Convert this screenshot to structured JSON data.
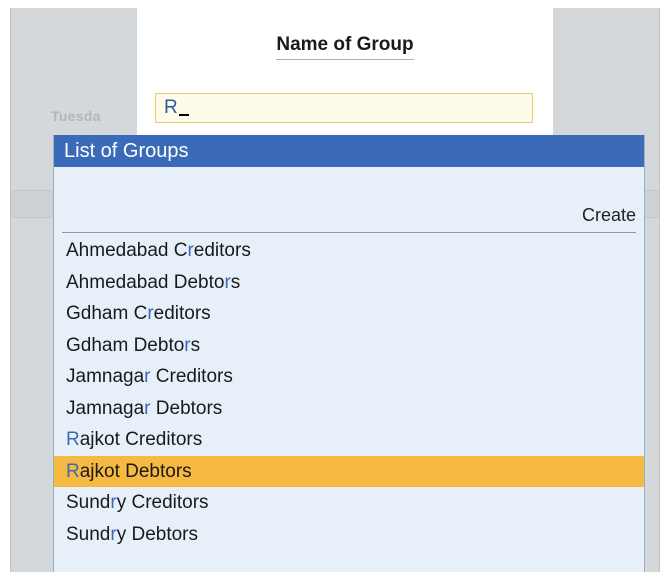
{
  "background": {
    "date_fragment": "Tuesda"
  },
  "name_panel": {
    "title": "Name of Group",
    "input_value": "R"
  },
  "list": {
    "header": "List of Groups",
    "create_label": "Create",
    "selected_index": 7,
    "items": [
      {
        "pre": "Ahmedabad C",
        "hl": "r",
        "post": "editors"
      },
      {
        "pre": "Ahmedabad Debto",
        "hl": "r",
        "post": "s"
      },
      {
        "pre": "Gdham C",
        "hl": "r",
        "post": "editors"
      },
      {
        "pre": "Gdham Debto",
        "hl": "r",
        "post": "s"
      },
      {
        "pre": "Jamnaga",
        "hl": "r",
        "post": " Creditors"
      },
      {
        "pre": "Jamnaga",
        "hl": "r",
        "post": " Debtors"
      },
      {
        "pre": "",
        "hl": "R",
        "post": "ajkot Creditors"
      },
      {
        "pre": "",
        "hl": "R",
        "post": "ajkot Debtors"
      },
      {
        "pre": "Sund",
        "hl": "r",
        "post": "y Creditors"
      },
      {
        "pre": "Sund",
        "hl": "r",
        "post": "y Debtors"
      }
    ]
  },
  "colors": {
    "header_bg": "#3a6ab8",
    "list_bg": "#e7f0f9",
    "selected_bg": "#f6ba42",
    "match_highlight": "#3a6ab8",
    "input_border": "#e2cf6e"
  }
}
